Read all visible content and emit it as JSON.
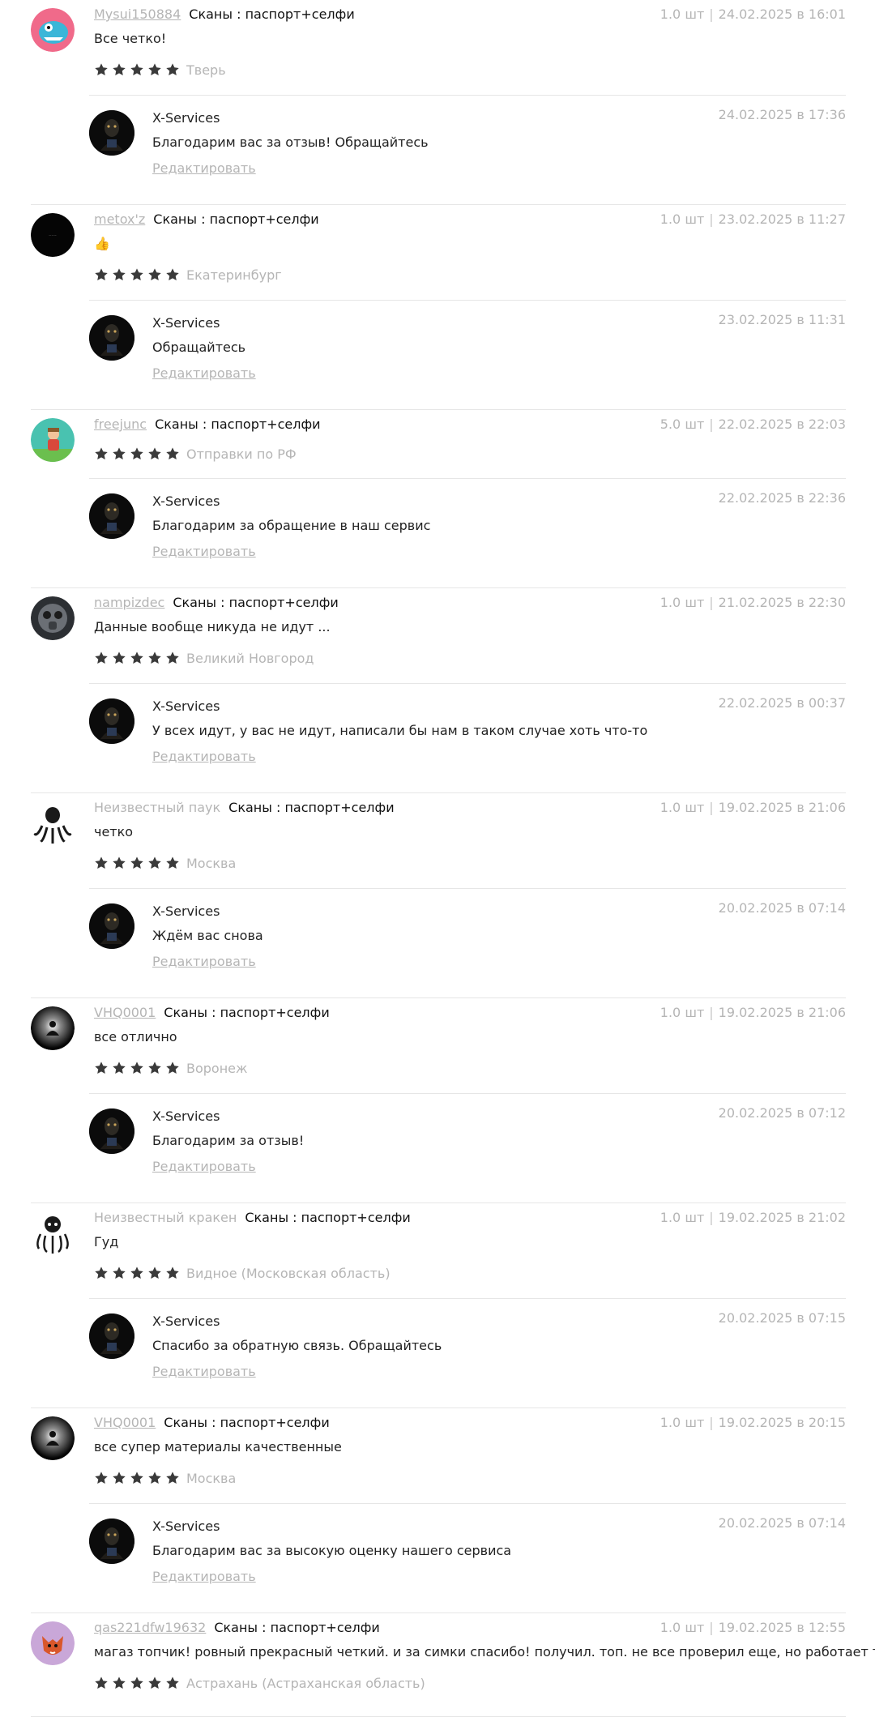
{
  "reviews": [
    {
      "user": "Mysui150884",
      "user_link": true,
      "avatar": "blue-creature-avatar",
      "product": "Сканы : паспорт+селфи",
      "qty": "1.0 шт",
      "date": "24.02.2025 в 16:01",
      "text": "Все четко!",
      "rating": 5,
      "location": "Тверь",
      "reply": {
        "author": "X-Services",
        "date": "24.02.2025 в 17:36",
        "text": "Благодарим вас за отзыв! Обращайтесь",
        "edit_label": "Редактировать"
      }
    },
    {
      "user": "metox'z",
      "user_link": true,
      "avatar": "black-avatar",
      "product": "Сканы : паспорт+селфи",
      "qty": "1.0 шт",
      "date": "23.02.2025 в 11:27",
      "text": "👍",
      "rating": 5,
      "location": "Екатеринбург",
      "reply": {
        "author": "X-Services",
        "date": "23.02.2025 в 11:31",
        "text": "Обращайтесь",
        "edit_label": "Редактировать"
      }
    },
    {
      "user": "freejunc",
      "user_link": true,
      "avatar": "cartoon-character-avatar",
      "product": "Сканы : паспорт+селфи",
      "qty": "5.0 шт",
      "date": "22.02.2025 в 22:03",
      "text": "",
      "rating": 5,
      "location": "Отправки по РФ",
      "reply": {
        "author": "X-Services",
        "date": "22.02.2025 в 22:36",
        "text": "Благодарим за обращение в наш сервис",
        "edit_label": "Редактировать"
      }
    },
    {
      "user": "nampizdec",
      "user_link": true,
      "avatar": "gas-mask-avatar",
      "product": "Сканы : паспорт+селфи",
      "qty": "1.0 шт",
      "date": "21.02.2025 в 22:30",
      "text": "Данные вообще никуда не идут ...",
      "rating": 5,
      "location": "Великий Новгород",
      "reply": {
        "author": "X-Services",
        "date": "22.02.2025 в 00:37",
        "text": "У всех идут, у вас не идут, написали бы нам в таком случае хоть что-то",
        "edit_label": "Редактировать"
      }
    },
    {
      "user": "Неизвестный паук",
      "user_link": false,
      "avatar": "octopus-avatar",
      "product": "Сканы : паспорт+селфи",
      "qty": "1.0 шт",
      "date": "19.02.2025 в 21:06",
      "text": "четко",
      "rating": 5,
      "location": "Москва",
      "reply": {
        "author": "X-Services",
        "date": "20.02.2025 в 07:14",
        "text": "Ждём вас снова",
        "edit_label": "Редактировать"
      }
    },
    {
      "user": "VHQ0001",
      "user_link": true,
      "avatar": "meditation-avatar",
      "product": "Сканы : паспорт+селфи",
      "qty": "1.0 шт",
      "date": "19.02.2025 в 21:06",
      "text": "все отлично",
      "rating": 5,
      "location": "Воронеж",
      "reply": {
        "author": "X-Services",
        "date": "20.02.2025 в 07:12",
        "text": "Благодарим за отзыв!",
        "edit_label": "Редактировать"
      }
    },
    {
      "user": "Неизвестный кракен",
      "user_link": false,
      "avatar": "kraken-avatar",
      "product": "Сканы : паспорт+селфи",
      "qty": "1.0 шт",
      "date": "19.02.2025 в 21:02",
      "text": "Гуд",
      "rating": 5,
      "location": "Видное (Московская область)",
      "reply": {
        "author": "X-Services",
        "date": "20.02.2025 в 07:15",
        "text": "Спасибо за обратную связь. Обращайтесь",
        "edit_label": "Редактировать"
      }
    },
    {
      "user": "VHQ0001",
      "user_link": true,
      "avatar": "meditation-avatar",
      "product": "Сканы : паспорт+селфи",
      "qty": "1.0 шт",
      "date": "19.02.2025 в 20:15",
      "text": "все супер материалы качественные",
      "rating": 5,
      "location": "Москва",
      "reply": {
        "author": "X-Services",
        "date": "20.02.2025 в 07:14",
        "text": "Благодарим вас за высокую оценку нашего сервиса",
        "edit_label": "Редактировать"
      }
    },
    {
      "user": "qas221dfw19632",
      "user_link": true,
      "avatar": "fox-avatar",
      "product": "Сканы : паспорт+селфи",
      "qty": "1.0 шт",
      "date": "19.02.2025 в 12:55",
      "text": "магаз топчик! ровный прекрасный четкий. и за симки спасибо! получил. топ. не все проверил еще, но работает точно!",
      "rating": 5,
      "location": "Астрахань (Астраханская область)",
      "reply": null
    }
  ],
  "colors": {
    "muted": "#b5b5b5",
    "text": "#222222",
    "star": "#3a3a3a",
    "divider": "#e6e6e6"
  }
}
